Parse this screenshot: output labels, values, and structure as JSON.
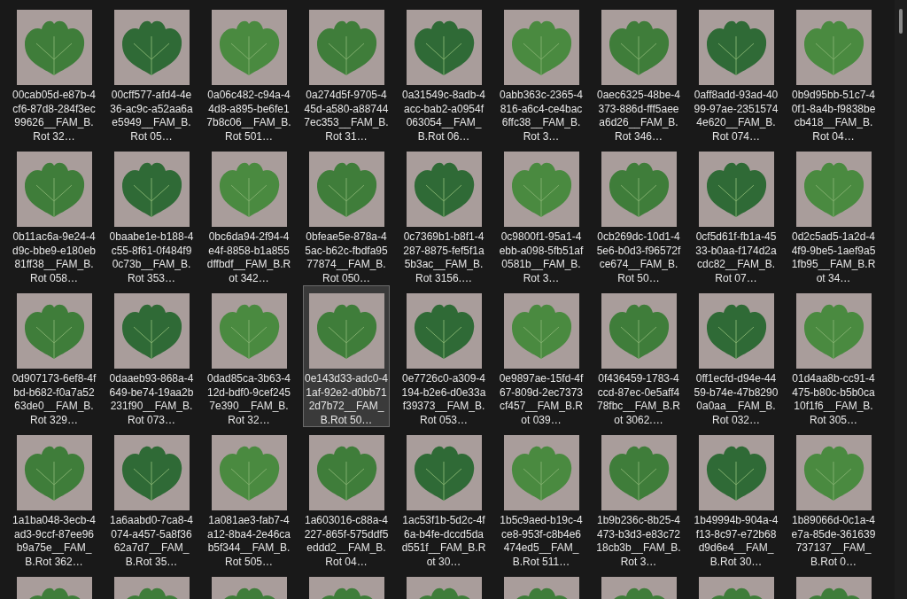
{
  "items": [
    {
      "name": "00cab05d-e87b-4cf6-87d8-284f3ec99626__FAM_B.Rot 32…",
      "selected": false
    },
    {
      "name": "00cff577-afd4-4e36-ac9c-a52aa6ae5949__FAM_B.Rot 05…",
      "selected": false
    },
    {
      "name": "0a06c482-c94a-44d8-a895-be6fe17b8c06__FAM_B.Rot 501…",
      "selected": false
    },
    {
      "name": "0a274d5f-9705-445d-a580-a887447ec353__FAM_B.Rot 31…",
      "selected": false
    },
    {
      "name": "0a31549c-8adb-4acc-bab2-a0954f063054__FAM_B.Rot 06…",
      "selected": false
    },
    {
      "name": "0abb363c-2365-4816-a6c4-ce4bac6ffc38__FAM_B.Rot 3…",
      "selected": false
    },
    {
      "name": "0aec6325-48be-4373-886d-fff5aeea6d26__FAM_B.Rot 346…",
      "selected": false
    },
    {
      "name": "0aff8add-93ad-4099-97ae-23515744e620__FAM_B.Rot 074…",
      "selected": false
    },
    {
      "name": "0b9d95bb-51c7-40f1-8a4b-f9838becb418__FAM_B.Rot 04…",
      "selected": false
    },
    {
      "name": "0b11ac6a-9e24-4d9c-bbe9-e180eb81ff38__FAM_B.Rot 058…",
      "selected": false
    },
    {
      "name": "0baabe1e-b188-4c55-8f61-0f484f90c73b__FAM_B.Rot 353…",
      "selected": false
    },
    {
      "name": "0bc6da94-2f94-4e4f-8858-b1a855dffbdf__FAM_B.Rot 342…",
      "selected": false
    },
    {
      "name": "0bfeae5e-878a-45ac-b62c-fbdfa9577874__FAM_B.Rot 050…",
      "selected": false
    },
    {
      "name": "0c7369b1-b8f1-4287-8875-fef5f1a5b3ac__FAM_B.Rot 3156.…",
      "selected": false
    },
    {
      "name": "0c9800f1-95a1-4ebb-a098-5fb51af0581b__FAM_B.Rot 3…",
      "selected": false
    },
    {
      "name": "0cb269dc-10d1-45e6-b0d3-f96572fce674__FAM_B.Rot 50…",
      "selected": false
    },
    {
      "name": "0cf5d61f-fb1a-4533-b0aa-f174d2acdc82__FAM_B.Rot 07…",
      "selected": false
    },
    {
      "name": "0d2c5ad5-1a2d-44f9-9be5-1aef9a51fb95__FAM_B.Rot 34…",
      "selected": false
    },
    {
      "name": "0d907173-6ef8-4fbd-b682-f0a7a5263de0__FAM_B.Rot 329…",
      "selected": false
    },
    {
      "name": "0daaeb93-868a-4649-be74-19aa2b231f90__FAM_B.Rot 073…",
      "selected": false
    },
    {
      "name": "0dad85ca-3b63-412d-bdf0-9cef2457e390__FAM_B.Rot 32…",
      "selected": false
    },
    {
      "name": "0e143d33-adc0-41af-92e2-d0bb712d7b72__FAM_B.Rot 50…",
      "selected": true
    },
    {
      "name": "0e7726c0-a309-4194-b2e6-d0e33af39373__FAM_B.Rot 053…",
      "selected": false
    },
    {
      "name": "0e9897ae-15fd-4f67-809d-2ec7373cf457__FAM_B.Rot 039…",
      "selected": false
    },
    {
      "name": "0f436459-1783-4ccd-87ec-0e5aff478fbc__FAM_B.Rot 3062.…",
      "selected": false
    },
    {
      "name": "0ff1ecfd-d94e-4459-b74e-47b82900a0aa__FAM_B.Rot 032…",
      "selected": false
    },
    {
      "name": "01d4aa8b-cc91-4475-b80c-b5b0ca10f1f6__FAM_B.Rot 305…",
      "selected": false
    },
    {
      "name": "1a1ba048-3ecb-4ad3-9ccf-87ee96b9a75e__FAM_B.Rot 362…",
      "selected": false
    },
    {
      "name": "1a6aabd0-7ca8-4074-a457-5a8f3662a7d7__FAM_B.Rot 35…",
      "selected": false
    },
    {
      "name": "1a081ae3-fab7-4a12-8ba4-2e46cab5f344__FAM_B.Rot 505…",
      "selected": false
    },
    {
      "name": "1a603016-c88a-4227-865f-575ddf5eddd2__FAM_B.Rot 04…",
      "selected": false
    },
    {
      "name": "1ac53f1b-5d2c-4f6a-b4fe-dccd5dad551f__FAM_B.Rot 30…",
      "selected": false
    },
    {
      "name": "1b5c9aed-b19c-4ce8-953f-c8b4e6474ed5__FAM_B.Rot 511…",
      "selected": false
    },
    {
      "name": "1b9b236c-8b25-4473-b3d3-e83c7218cb3b__FAM_B.Rot 3…",
      "selected": false
    },
    {
      "name": "1b49994b-904a-4f13-8c97-e72b68d9d6e4__FAM_B.Rot 30…",
      "selected": false
    },
    {
      "name": "1b89066d-0c1a-4e7a-85de-361639737137__FAM_B.Rot 0…",
      "selected": false
    }
  ],
  "cut_off_items": [
    {
      "selected": false
    },
    {
      "selected": false
    },
    {
      "selected": false
    },
    {
      "selected": false
    },
    {
      "selected": false
    },
    {
      "selected": false
    },
    {
      "selected": false
    },
    {
      "selected": false
    },
    {
      "selected": false
    }
  ]
}
